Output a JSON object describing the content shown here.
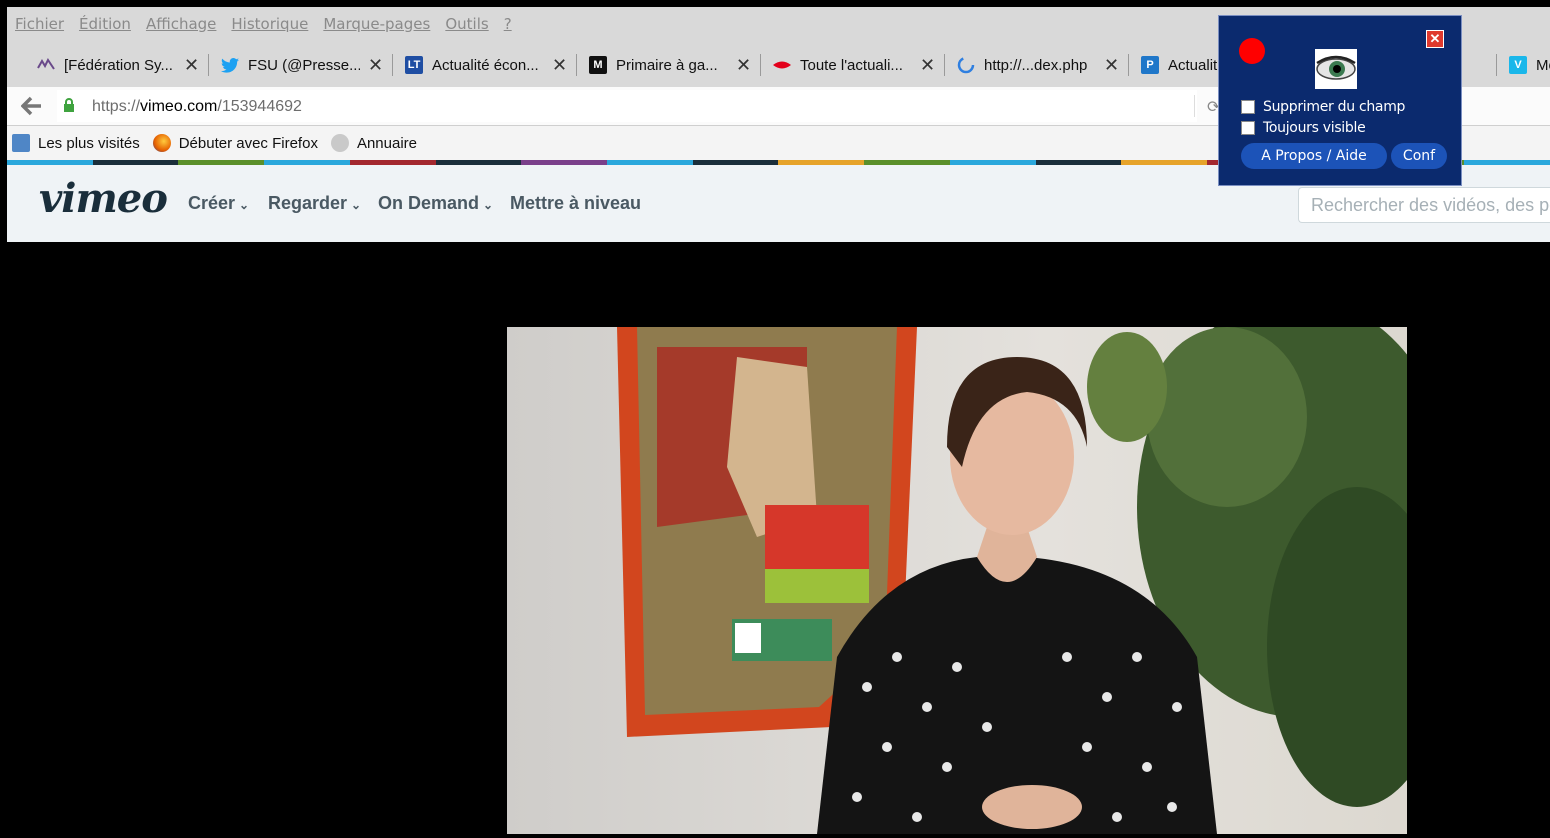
{
  "menu": [
    "Fichier",
    "Édition",
    "Affichage",
    "Historique",
    "Marque-pages",
    "Outils",
    "?"
  ],
  "tabs": [
    {
      "title": "[Fédération Sy...",
      "icon": "fsu-icon",
      "color": "#6a4a8a"
    },
    {
      "title": "FSU (@Presse...",
      "icon": "twitter-icon",
      "color": "#1da1f2"
    },
    {
      "title": "Actualité écon...",
      "icon": "lt-icon",
      "color": "#1f4ea3"
    },
    {
      "title": "Primaire à ga...",
      "icon": "le-monde-icon",
      "color": "#111111"
    },
    {
      "title": "Toute l'actuali...",
      "icon": "red-wave-icon",
      "color": "#e3001b"
    },
    {
      "title": "http://...dex.php",
      "icon": "loading-icon",
      "color": "#2f7fe0"
    },
    {
      "title": "Actualit",
      "icon": "p-icon",
      "color": "#1f77c9"
    },
    {
      "title": "Mo",
      "icon": "vimeo-icon",
      "color": "#1ab7ea"
    }
  ],
  "url": {
    "prefix": "https://",
    "host": "vimeo.com",
    "path": "/153944692"
  },
  "bookmarks": [
    "Les plus visités",
    "Débuter avec Firefox",
    "Annuaire"
  ],
  "stripe_colors": [
    "#2aa7dc",
    "#1a2e3b",
    "#5a8f2a",
    "#2aa7dc",
    "#a3282f",
    "#1a2e3b",
    "#7a3f8a",
    "#2aa7dc",
    "#1a2e3b",
    "#e6a32a",
    "#5a8f2a",
    "#2aa7dc",
    "#1a2e3b",
    "#e6a32a",
    "#a3282f",
    "#7a3f8a",
    "#5a8f2a",
    "#2aa7dc"
  ],
  "vimeo": {
    "logo": "vimeo",
    "nav": [
      {
        "label": "Créer",
        "dropdown": true
      },
      {
        "label": "Regarder",
        "dropdown": true
      },
      {
        "label": "On Demand",
        "dropdown": true
      },
      {
        "label": "Mettre à niveau",
        "dropdown": false
      }
    ],
    "search_placeholder": "Rechercher des vidéos, des per"
  },
  "widget": {
    "checkbox1": "Supprimer du champ",
    "checkbox2": "Toujours visible",
    "about_label": "A Propos / Aide",
    "conf_label": "Conf"
  }
}
